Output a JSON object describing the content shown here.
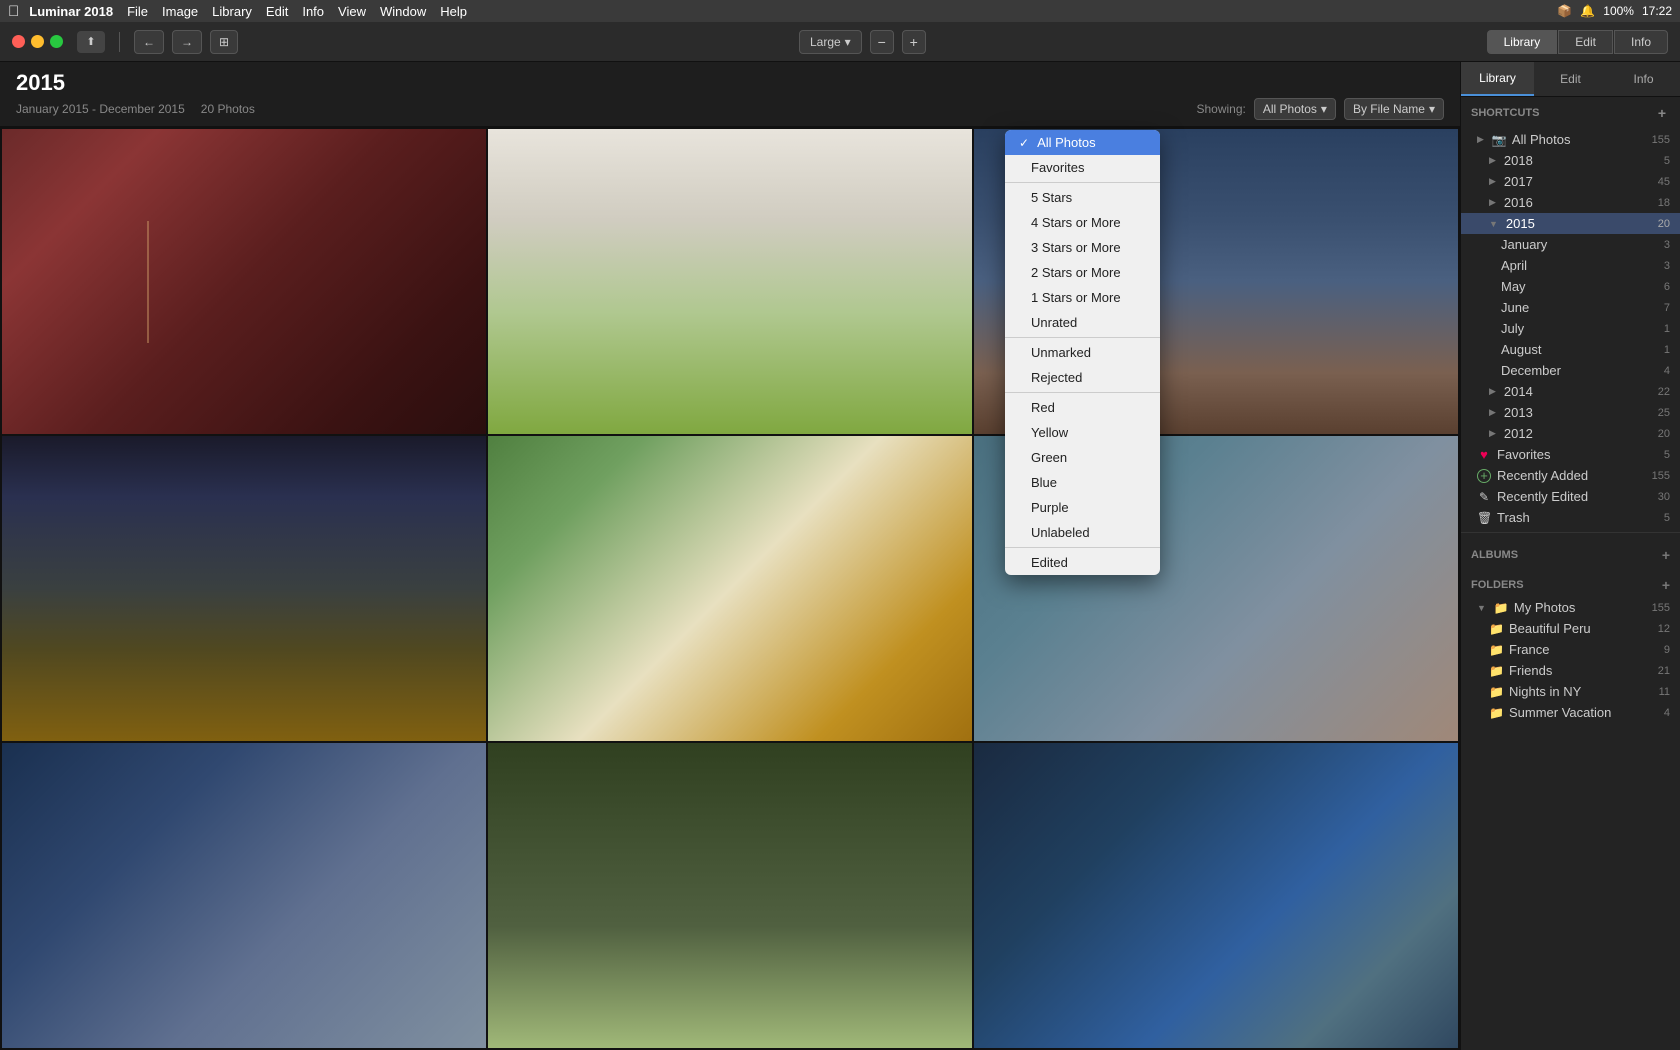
{
  "app": {
    "name": "Luminar 2018",
    "menu": [
      "File",
      "Image",
      "Library",
      "Edit",
      "Info",
      "View",
      "Window",
      "Help"
    ],
    "status": "100%",
    "time": "17:22"
  },
  "toolbar": {
    "back_label": "←",
    "forward_label": "→",
    "upload_label": "↑",
    "view_btn_label": "⊞",
    "size_label": "Large",
    "zoom_minus": "−",
    "zoom_plus": "+",
    "tabs": [
      "Library",
      "Edit",
      "Info"
    ],
    "active_tab": "Library"
  },
  "content": {
    "title": "2015",
    "date_range": "January 2015 - December 2015",
    "photo_count": "20 Photos",
    "showing_label": "Showing:",
    "filter_label": "All Photos",
    "sort_label": "By File Name"
  },
  "dropdown": {
    "items": [
      {
        "id": "all-photos",
        "label": "All Photos",
        "active": true
      },
      {
        "id": "favorites",
        "label": "Favorites",
        "active": false
      },
      {
        "id": "sep1",
        "type": "separator"
      },
      {
        "id": "5stars",
        "label": "5 Stars",
        "active": false
      },
      {
        "id": "4stars",
        "label": "4 Stars or More",
        "active": false
      },
      {
        "id": "3stars",
        "label": "3 Stars or More",
        "active": false
      },
      {
        "id": "2stars",
        "label": "2 Stars or More",
        "active": false
      },
      {
        "id": "1stars",
        "label": "1 Stars or More",
        "active": false
      },
      {
        "id": "unrated",
        "label": "Unrated",
        "active": false
      },
      {
        "id": "sep2",
        "type": "separator"
      },
      {
        "id": "unmarked",
        "label": "Unmarked",
        "active": false
      },
      {
        "id": "rejected",
        "label": "Rejected",
        "active": false
      },
      {
        "id": "sep3",
        "type": "separator"
      },
      {
        "id": "red",
        "label": "Red",
        "active": false
      },
      {
        "id": "yellow",
        "label": "Yellow",
        "active": false
      },
      {
        "id": "green",
        "label": "Green",
        "active": false
      },
      {
        "id": "blue",
        "label": "Blue",
        "active": false
      },
      {
        "id": "purple",
        "label": "Purple",
        "active": false
      },
      {
        "id": "unlabeled",
        "label": "Unlabeled",
        "active": false
      },
      {
        "id": "sep4",
        "type": "separator"
      },
      {
        "id": "edited",
        "label": "Edited",
        "active": false
      }
    ]
  },
  "sidebar": {
    "tabs": [
      "Library",
      "Edit",
      "Info"
    ],
    "shortcuts_header": "Shortcuts",
    "tree": [
      {
        "id": "all-photos",
        "label": "All Photos",
        "count": "155",
        "icon": "📷",
        "indent": 0
      },
      {
        "id": "y2018",
        "label": "2018",
        "count": "5",
        "icon": "▶",
        "indent": 1
      },
      {
        "id": "y2017",
        "label": "2017",
        "count": "45",
        "icon": "▶",
        "indent": 1
      },
      {
        "id": "y2016",
        "label": "2016",
        "count": "18",
        "icon": "▶",
        "indent": 1
      },
      {
        "id": "y2015",
        "label": "2015",
        "count": "20",
        "icon": "▶",
        "indent": 1,
        "selected": true
      },
      {
        "id": "m-jan",
        "label": "January",
        "count": "3",
        "indent": 2
      },
      {
        "id": "m-apr",
        "label": "April",
        "count": "3",
        "indent": 2
      },
      {
        "id": "m-may",
        "label": "May",
        "count": "6",
        "indent": 2
      },
      {
        "id": "m-jun",
        "label": "June",
        "count": "7",
        "indent": 2
      },
      {
        "id": "m-jul",
        "label": "July",
        "count": "1",
        "indent": 2
      },
      {
        "id": "m-aug",
        "label": "August",
        "count": "1",
        "indent": 2
      },
      {
        "id": "m-dec",
        "label": "December",
        "count": "4",
        "indent": 2
      },
      {
        "id": "y2014",
        "label": "2014",
        "count": "22",
        "icon": "▶",
        "indent": 1
      },
      {
        "id": "y2013",
        "label": "2013",
        "count": "25",
        "icon": "▶",
        "indent": 1
      },
      {
        "id": "y2012",
        "label": "2012",
        "count": "20",
        "icon": "▶",
        "indent": 1
      },
      {
        "id": "favorites",
        "label": "Favorites",
        "count": "5",
        "icon": "♥",
        "indent": 0
      },
      {
        "id": "recently-added",
        "label": "Recently Added",
        "count": "155",
        "icon": "+",
        "indent": 0
      },
      {
        "id": "recently-edited",
        "label": "Recently Edited",
        "count": "30",
        "icon": "✏",
        "indent": 0
      },
      {
        "id": "trash",
        "label": "Trash",
        "count": "5",
        "icon": "🗑",
        "indent": 0
      }
    ],
    "albums_header": "Albums",
    "folders_header": "Folders",
    "folders": [
      {
        "id": "my-photos",
        "label": "My Photos",
        "count": "155",
        "icon": "📁",
        "indent": 0
      },
      {
        "id": "beautiful-peru",
        "label": "Beautiful Peru",
        "count": "12",
        "icon": "📁",
        "indent": 1
      },
      {
        "id": "france",
        "label": "France",
        "count": "9",
        "icon": "📁",
        "indent": 1
      },
      {
        "id": "friends",
        "label": "Friends",
        "count": "21",
        "icon": "📁",
        "indent": 1
      },
      {
        "id": "nights-in-ny",
        "label": "Nights in NY",
        "count": "11",
        "icon": "📁",
        "indent": 1
      },
      {
        "id": "summer-vacation",
        "label": "Summer Vacation",
        "count": "4",
        "icon": "📁",
        "indent": 1
      }
    ]
  }
}
